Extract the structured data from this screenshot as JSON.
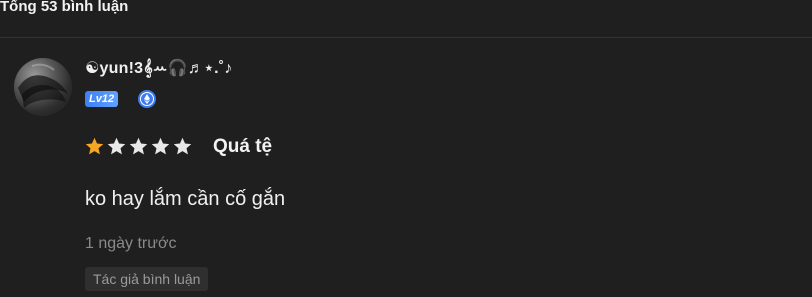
{
  "header": {
    "title": "Tổng 53 bình luận"
  },
  "comment": {
    "username": "☯yun!3𝄞ꕀ🎧♬⋆.˚♪",
    "level": "Lv12",
    "verify_icon": "ethereum-diamond-icon",
    "rating": {
      "value": 1,
      "max": 5,
      "label": "Quá tệ",
      "filled_color": "#f5a623",
      "empty_color": "#e8e8e8"
    },
    "text": "ko hay lắm cần cố gắn",
    "timestamp": "1 ngày trước",
    "author_tag": "Tác giả bình luận"
  },
  "colors": {
    "background": "#1f1f1f",
    "level_badge": "#4a8cf7",
    "muted_text": "#8a8a8a"
  }
}
